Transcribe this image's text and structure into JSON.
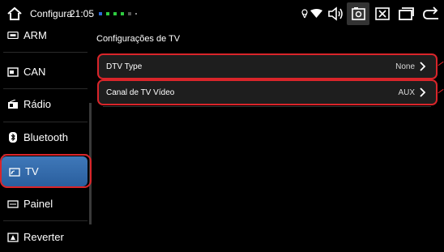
{
  "statusbar": {
    "app_title": "Configura",
    "time": "21:05",
    "notification_colors": [
      "#2e6bd6",
      "#2ecc40",
      "#2ecc40",
      "#2ecc40",
      "#555555",
      "#888888"
    ]
  },
  "sidebar": {
    "items": [
      {
        "label": "ARM",
        "icon": "arm-chip-icon"
      },
      {
        "label": "CAN",
        "icon": "can-module-icon"
      },
      {
        "label": "Rádio",
        "icon": "radio-icon"
      },
      {
        "label": "Bluetooth",
        "icon": "bluetooth-icon"
      },
      {
        "label": "TV",
        "icon": "tv-icon",
        "active": true
      },
      {
        "label": "Painel",
        "icon": "panel-icon"
      },
      {
        "label": "Reverter",
        "icon": "reverse-camera-icon"
      }
    ]
  },
  "main": {
    "title": "Configurações de TV",
    "rows": [
      {
        "label": "DTV Type",
        "value": "None"
      },
      {
        "label": "Canal de TV Vídeo",
        "value": "AUX"
      }
    ]
  },
  "colors": {
    "accent": "#3f78b9",
    "highlight": "#d9252a",
    "row_bg": "#1e1e1e"
  }
}
